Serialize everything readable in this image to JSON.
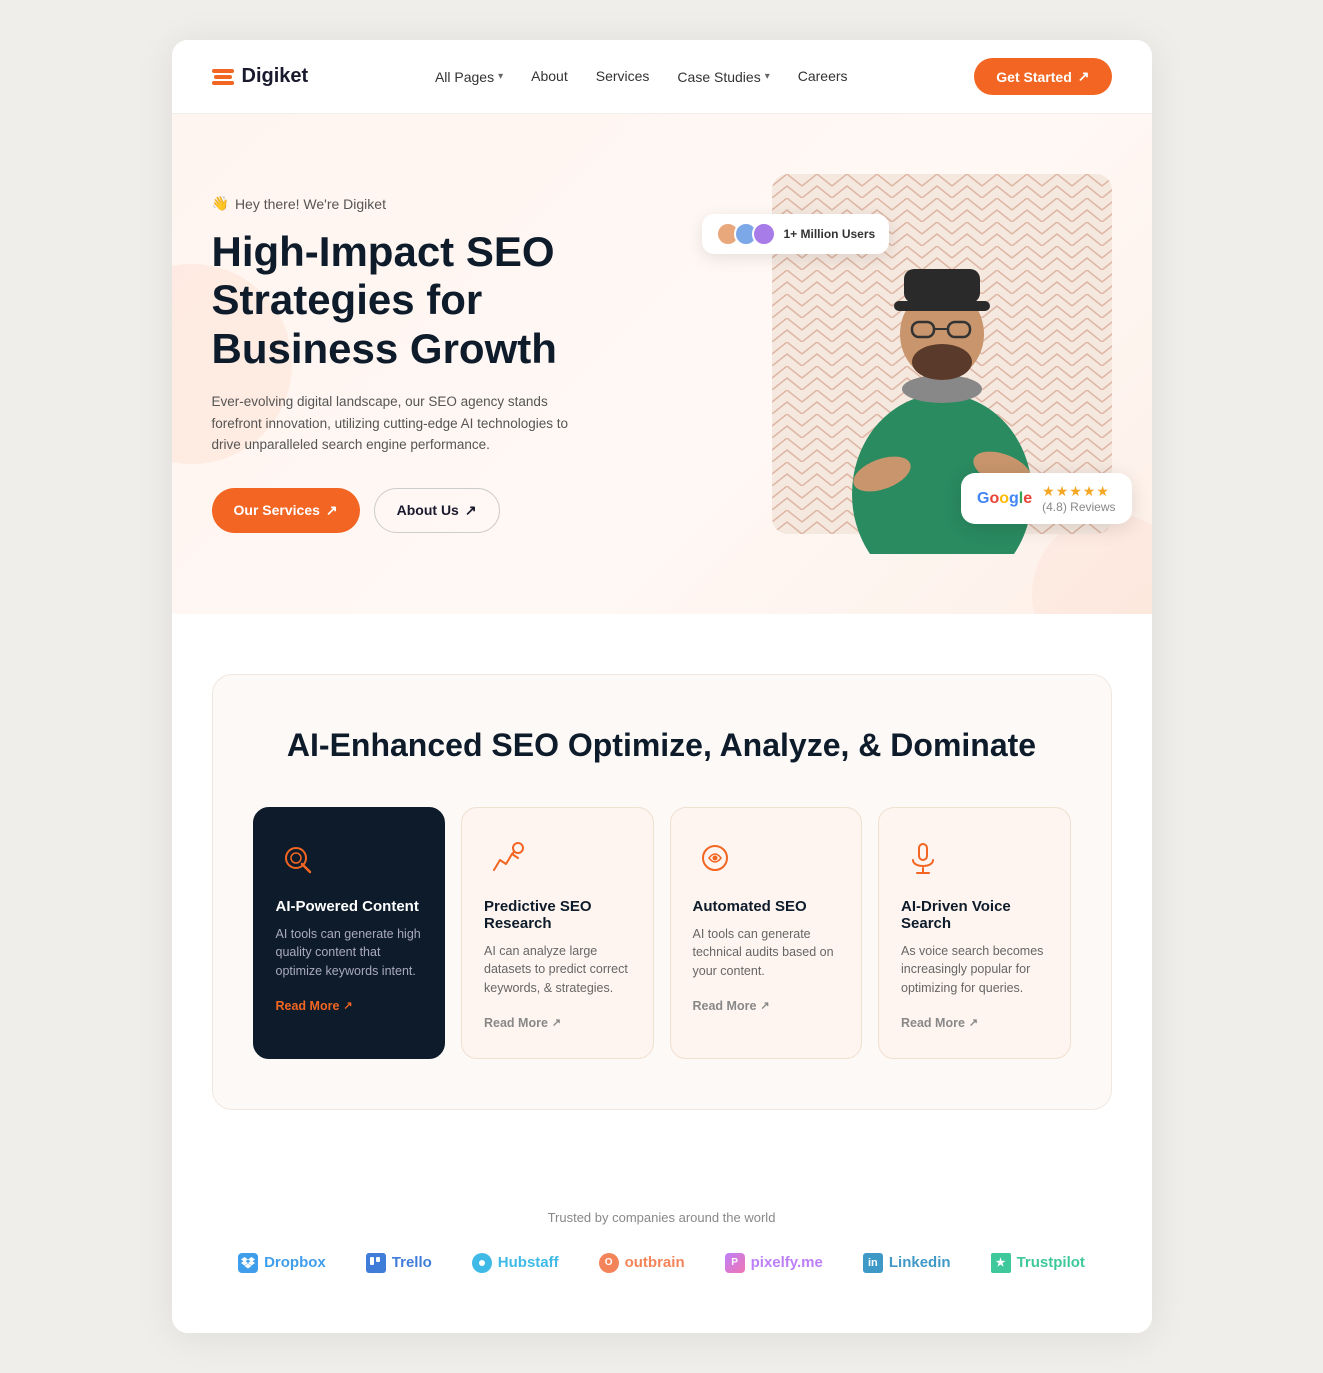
{
  "navbar": {
    "logo_text": "Digiket",
    "links": [
      {
        "label": "All Pages",
        "dropdown": true
      },
      {
        "label": "About"
      },
      {
        "label": "Services"
      },
      {
        "label": "Case Studies",
        "dropdown": true
      },
      {
        "label": "Careers"
      }
    ],
    "cta_label": "Get Started"
  },
  "hero": {
    "tag_emoji": "👋",
    "tag_text": "Hey there! We're Digiket",
    "title": "High-Impact SEO Strategies for Business Growth",
    "description": "Ever-evolving digital landscape, our SEO agency stands forefront innovation, utilizing cutting-edge AI technologies to drive unparalleled search engine performance.",
    "btn_primary": "Our Services",
    "btn_secondary": "About Us",
    "badge_users": "1+ Million Users",
    "badge_google_rating": "(4.8) Reviews",
    "stars_count": "★★★★★"
  },
  "services": {
    "section_title": "AI-Enhanced SEO Optimize, Analyze, & Dominate",
    "cards": [
      {
        "id": "ai-content",
        "title": "AI-Powered Content",
        "description": "AI tools can generate high quality content that optimize keywords intent.",
        "read_more": "Read More",
        "dark": true
      },
      {
        "id": "predictive-seo",
        "title": "Predictive SEO Research",
        "description": "AI can analyze large datasets to predict correct keywords, & strategies.",
        "read_more": "Read More",
        "dark": false
      },
      {
        "id": "automated-seo",
        "title": "Automated SEO",
        "description": "AI tools can generate technical audits based on your content.",
        "read_more": "Read More",
        "dark": false
      },
      {
        "id": "voice-search",
        "title": "AI-Driven Voice Search",
        "description": "As voice search becomes increasingly popular for optimizing for queries.",
        "read_more": "Read More",
        "dark": false
      }
    ]
  },
  "trusted": {
    "title": "Trusted by companies around the world",
    "brands": [
      {
        "name": "Dropbox",
        "class": "dropbox"
      },
      {
        "name": "Trello",
        "class": "trello"
      },
      {
        "name": "Hubstaff",
        "class": "hubstaff"
      },
      {
        "name": "Outbrain",
        "class": "outbrain"
      },
      {
        "name": "pixelfy.me",
        "class": "pixelfy"
      },
      {
        "name": "LinkedIn",
        "class": "linkedin-brand"
      },
      {
        "name": "Trustpilot",
        "class": "trustpilot"
      }
    ]
  }
}
